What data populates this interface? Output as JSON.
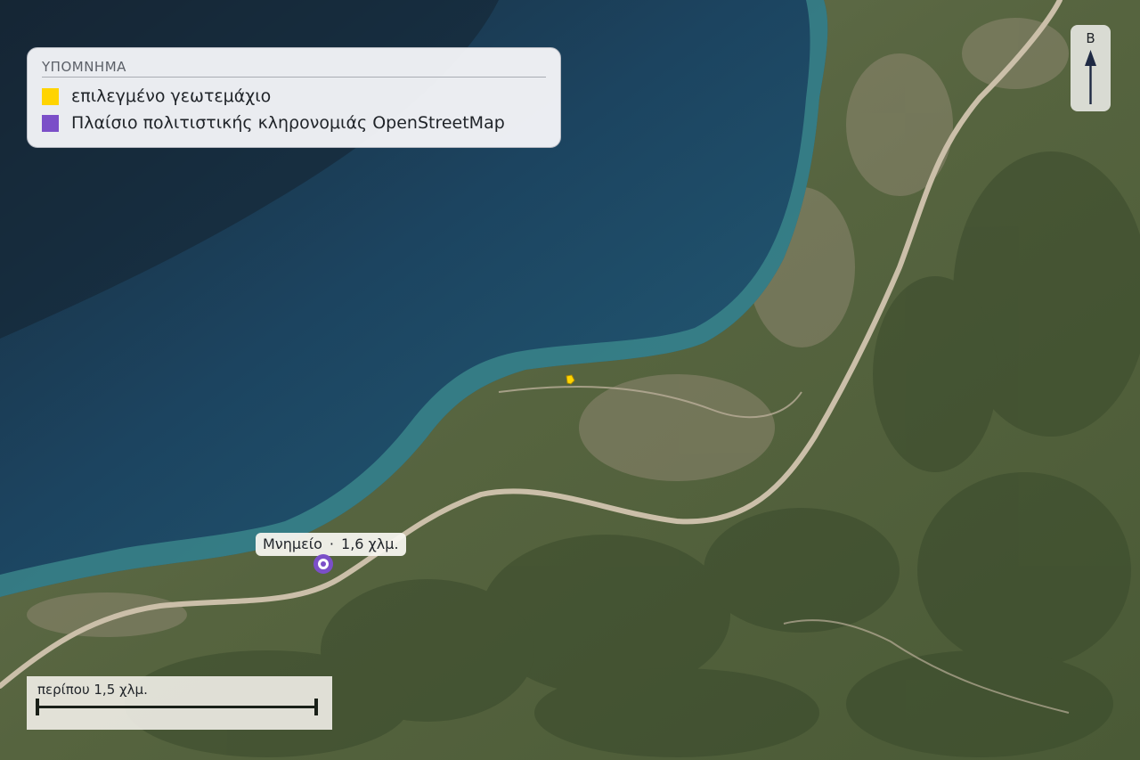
{
  "legend": {
    "title": "ΥΠΟΜΝΗΜΑ",
    "items": [
      {
        "label": "επιλεγμένο γεωτεμάχιο",
        "color": "#FFD400"
      },
      {
        "label": "Πλαίσιο πολιτιστικής κληρονομιάς OpenStreetMap",
        "color": "#7B4FC8"
      }
    ]
  },
  "north_arrow": {
    "letter": "Β"
  },
  "poi": {
    "name": "Μνημείο",
    "separator": "·",
    "distance": "1,6 χλμ.",
    "color": "#7B4FC8"
  },
  "parcel": {
    "color": "#FFD400"
  },
  "scale_bar": {
    "label": "περίπου 1,5 χλμ."
  },
  "colors": {
    "sea_deep": "#1b2e42",
    "sea_mid": "#1e4f6e",
    "sea_shallow": "#3f8a8f",
    "land": "#566343",
    "hills": "#3e4f2f",
    "highway": "#c9bfae"
  }
}
